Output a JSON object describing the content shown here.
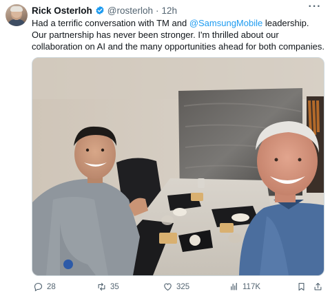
{
  "post": {
    "author_name": "Rick Osterloh",
    "handle": "@rosterloh",
    "separator": "·",
    "time": "12h",
    "text_part1": "Had a terrific conversation with TM and ",
    "mention": "@SamsungMobile",
    "text_part2": " leadership. Our partnership has never been stronger. I'm thrilled about our collaboration on AI and the many opportunities ahead for both companies."
  },
  "icons": {
    "verified": "verified-badge-icon",
    "more": "more-icon",
    "reply": "reply-icon",
    "repost": "repost-icon",
    "like": "like-icon",
    "views": "views-icon",
    "bookmark": "bookmark-icon",
    "share": "share-icon"
  },
  "actions": {
    "replies": "28",
    "reposts": "35",
    "likes": "325",
    "views": "117K"
  },
  "colors": {
    "accent": "#1d9bf0",
    "muted": "#536471",
    "text": "#0f1419"
  }
}
